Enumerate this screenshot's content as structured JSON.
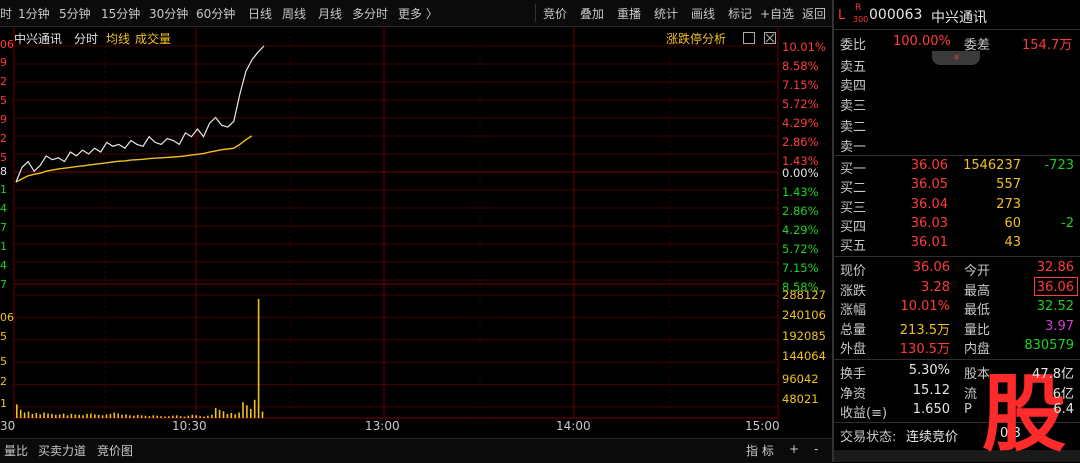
{
  "toolbar": {
    "left_items": [
      "时",
      "1分钟",
      "5分钟",
      "15分钟",
      "30分钟",
      "60分钟",
      "日线",
      "周线",
      "月线",
      "多分时",
      "更多 〉"
    ],
    "right_items": [
      "竞价",
      "叠加",
      "重播",
      "统计",
      "画线",
      "标记",
      "+自选",
      "返回"
    ]
  },
  "chart_header": {
    "stock_name": "中兴通讯",
    "tab_fenshi": "分时",
    "tab_junxian": "均线",
    "tab_volume": "成交量",
    "limit_analysis": "涨跌停分析"
  },
  "y_left_partial": [
    "06",
    "9",
    "2",
    "5",
    "9",
    "2",
    "5",
    "8",
    "1",
    "4",
    "7",
    "1",
    "4",
    "7",
    "06",
    "5",
    "5",
    "2",
    "1"
  ],
  "y_right_pct": [
    "10.01%",
    "8.58%",
    "7.15%",
    "5.72%",
    "4.29%",
    "2.86%",
    "1.43%",
    "0.00%",
    "1.43%",
    "2.86%",
    "4.29%",
    "5.72%",
    "7.15%",
    "8.58%"
  ],
  "y_right_vol": [
    "288127",
    "240106",
    "192085",
    "144064",
    "96042",
    "48021"
  ],
  "x_labels": [
    "30",
    "10:30",
    "13:00",
    "14:00",
    "15:00"
  ],
  "bottom": {
    "items": [
      "量比",
      "买卖力道",
      "竞价图"
    ],
    "index_label": "指 标",
    "plus": "+",
    "minus": "-"
  },
  "quote": {
    "market_flag": "L",
    "index_tag_top": "R",
    "index_tag_bottom": "300",
    "code": "000063",
    "name": "中兴通讯",
    "weibi_label": "委比",
    "weibi": "100.00%",
    "weicha_label": "委差",
    "weicha": "154.7万",
    "collapse_glyph": "»",
    "sell_labels": [
      "卖五",
      "卖四",
      "卖三",
      "卖二",
      "卖一"
    ],
    "buy": [
      {
        "label": "买一",
        "price": "36.06",
        "volume": "1546237",
        "change": "-723"
      },
      {
        "label": "买二",
        "price": "36.05",
        "volume": "557",
        "change": ""
      },
      {
        "label": "买三",
        "price": "36.04",
        "volume": "273",
        "change": ""
      },
      {
        "label": "买四",
        "price": "36.03",
        "volume": "60",
        "change": "-2"
      },
      {
        "label": "买五",
        "price": "36.01",
        "volume": "43",
        "change": ""
      }
    ],
    "stats": [
      {
        "l1": "现价",
        "v1": "36.06",
        "l2": "今开",
        "v2": "32.86"
      },
      {
        "l1": "涨跌",
        "v1": "3.28",
        "l2": "最高",
        "v2": "36.06"
      },
      {
        "l1": "涨幅",
        "v1": "10.01%",
        "l2": "最低",
        "v2": "32.52"
      },
      {
        "l1": "总量",
        "v1": "213.5万",
        "l2": "量比",
        "v2": "3.97"
      },
      {
        "l1": "外盘",
        "v1": "130.5万",
        "l2": "内盘",
        "v2": "830579"
      }
    ],
    "fin": [
      {
        "l1": "换手",
        "v1": "5.30%",
        "l2": "股本",
        "v2": "47.8亿"
      },
      {
        "l1": "净资",
        "v1": "15.12",
        "l2": "流",
        "v2": "6亿"
      },
      {
        "l1": "收益(≡)",
        "v1": "1.650",
        "l2": "P",
        "v2": "6.4"
      }
    ],
    "trade_state_label": "交易状态:",
    "trade_state": "连续竞价",
    "trade_state_tail": "0:3"
  },
  "watermark": "股",
  "colors": {
    "up": "#ff3b3b",
    "down": "#20d020",
    "avg": "#f0c020",
    "grid": "#5a0000",
    "price": "#e8e8e8"
  },
  "chart_data": {
    "type": "line",
    "title": "中兴通讯 分时",
    "prev_close": 32.78,
    "price_ylim": [
      29.5,
      36.06
    ],
    "pct_ticks": [
      10.01,
      8.58,
      7.15,
      5.72,
      4.29,
      2.86,
      1.43,
      0.0,
      -1.43,
      -2.86,
      -4.29,
      -5.72,
      -7.15,
      -8.58
    ],
    "series": [
      {
        "name": "价格",
        "values": [
          32.52,
          32.9,
          33.05,
          32.8,
          32.95,
          33.2,
          33.1,
          33.15,
          33.05,
          33.3,
          33.2,
          33.35,
          33.25,
          33.4,
          33.3,
          33.55,
          33.45,
          33.5,
          33.4,
          33.6,
          33.5,
          33.45,
          33.7,
          33.55,
          33.5,
          33.65,
          33.6,
          33.5,
          33.8,
          33.7,
          33.9,
          33.7,
          34.05,
          34.2,
          34.0,
          33.95,
          34.1,
          34.8,
          35.4,
          35.7,
          35.9,
          36.06
        ]
      },
      {
        "name": "均线",
        "values": [
          32.52,
          32.6,
          32.68,
          32.72,
          32.75,
          32.8,
          32.83,
          32.86,
          32.88,
          32.9,
          32.92,
          32.94,
          32.96,
          32.98,
          33.0,
          33.02,
          33.04,
          33.06,
          33.07,
          33.09,
          33.1,
          33.11,
          33.13,
          33.14,
          33.15,
          33.16,
          33.17,
          33.18,
          33.2,
          33.22,
          33.24,
          33.26,
          33.3,
          33.33,
          33.36,
          33.38,
          33.4,
          33.5,
          33.62,
          33.72,
          33.8,
          33.88
        ]
      }
    ],
    "volume": {
      "name": "成交量",
      "ylim": [
        0,
        288127
      ],
      "ticks": [
        288127,
        240106,
        192085,
        144064,
        96042,
        48021
      ],
      "values": [
        30000,
        18000,
        12000,
        14000,
        9000,
        11000,
        8000,
        12000,
        10000,
        9000,
        7000,
        8000,
        10000,
        6000,
        9000,
        8000,
        7000,
        6000,
        9000,
        10000,
        8000,
        7000,
        6000,
        8000,
        9000,
        12000,
        10000,
        7000,
        8000,
        6000,
        5000,
        7000,
        6000,
        5000,
        4000,
        6000,
        5000,
        4000,
        3000,
        4000,
        5000,
        6000,
        4000,
        3000,
        5000,
        7000,
        6000,
        4000,
        3000,
        5000,
        7000,
        22000,
        18000,
        15000,
        9000,
        11000,
        8000,
        12000,
        35000,
        28000,
        20000,
        40000,
        262000,
        14000
      ]
    },
    "x_ticks": [
      "10:30",
      "13:00",
      "14:00",
      "15:00"
    ]
  }
}
